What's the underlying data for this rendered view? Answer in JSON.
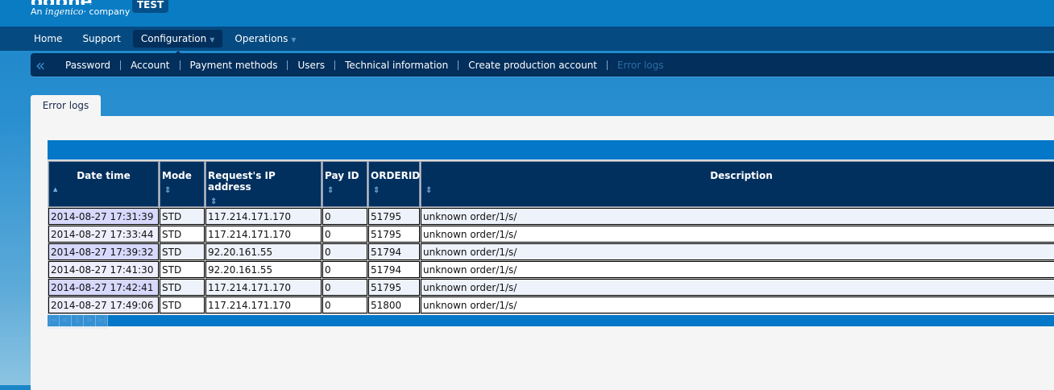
{
  "header": {
    "logo_text": "ogone",
    "logo_tagline_prefix": "An",
    "logo_tagline_brand": "ingenico",
    "logo_tagline_suffix": "company",
    "env_badge": "TEST"
  },
  "nav": {
    "items": [
      {
        "label": "Home"
      },
      {
        "label": "Support"
      },
      {
        "label": "Configuration",
        "active": true
      },
      {
        "label": "Operations"
      }
    ]
  },
  "subnav": {
    "items": [
      "Password",
      "Account",
      "Payment methods",
      "Users",
      "Technical information",
      "Create production account",
      "Error logs"
    ]
  },
  "tab": "Error logs",
  "table": {
    "columns": [
      "Date time",
      "Mode",
      "Request's IP address",
      "Pay ID",
      "ORDERID",
      "Description"
    ],
    "rows": [
      [
        "2014-08-27 17:31:39",
        "STD",
        "117.214.171.170",
        "0",
        "51795",
        "unknown order/1/s/"
      ],
      [
        "2014-08-27 17:33:44",
        "STD",
        "117.214.171.170",
        "0",
        "51795",
        "unknown order/1/s/"
      ],
      [
        "2014-08-27 17:39:32",
        "STD",
        "92.20.161.55",
        "0",
        "51794",
        "unknown order/1/s/"
      ],
      [
        "2014-08-27 17:41:30",
        "STD",
        "92.20.161.55",
        "0",
        "51794",
        "unknown order/1/s/"
      ],
      [
        "2014-08-27 17:42:41",
        "STD",
        "117.214.171.170",
        "0",
        "51795",
        "unknown order/1/s/"
      ],
      [
        "2014-08-27 17:49:06",
        "STD",
        "117.214.171.170",
        "0",
        "51800",
        "unknown order/1/s/"
      ]
    ]
  },
  "pager": {
    "first": "|<",
    "prev": "<",
    "page": "1",
    "next": ">",
    "last": ">|"
  }
}
